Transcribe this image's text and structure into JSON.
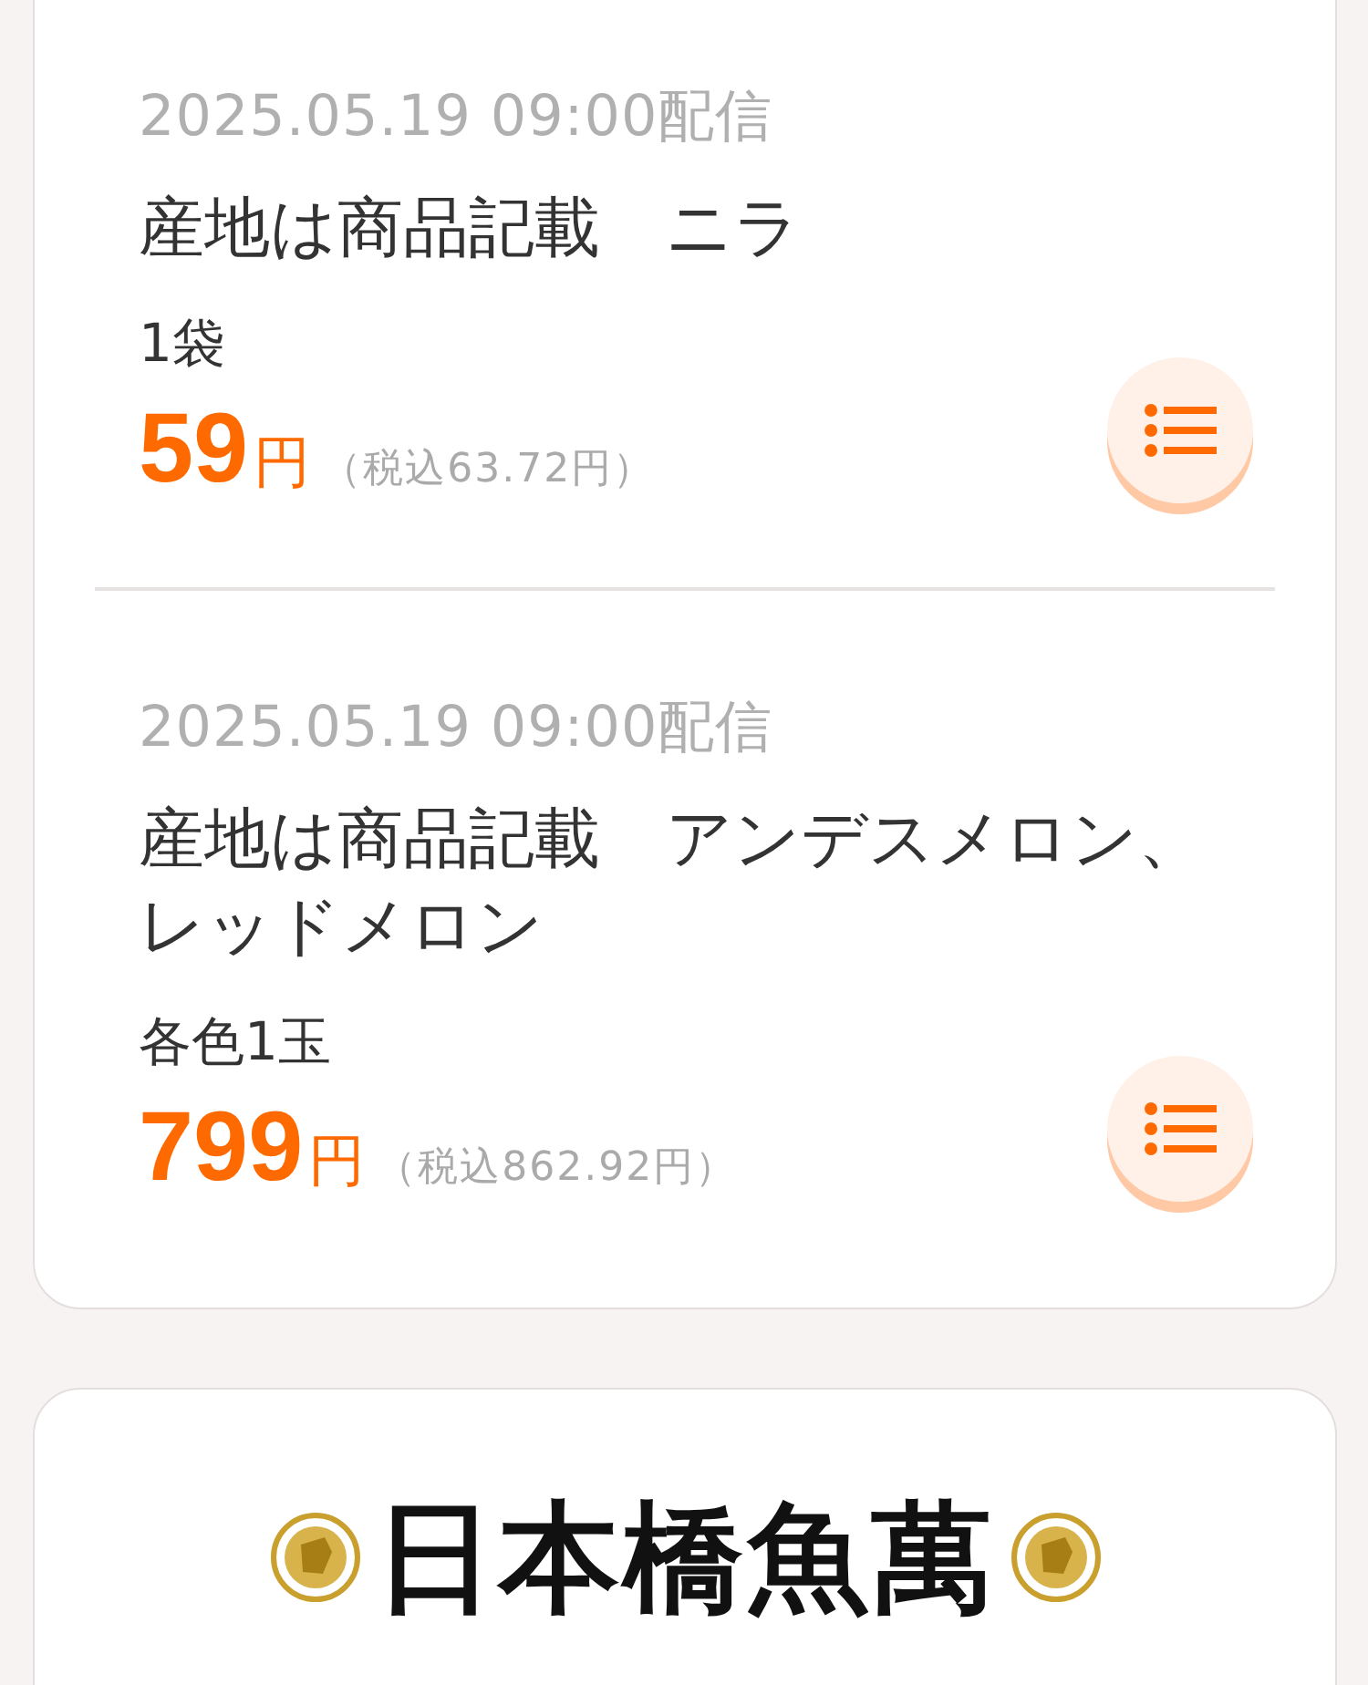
{
  "products": [
    {
      "date": "2025.05.19 09:00配信",
      "title": "産地は商品記載　ニラ",
      "unit": "1袋",
      "price": "59",
      "currency": "円",
      "tax_included": "（税込63.72円）"
    },
    {
      "date": "2025.05.19 09:00配信",
      "title": "産地は商品記載　アンデスメロン、レッドメロン",
      "unit": "各色1玉",
      "price": "799",
      "currency": "円",
      "tax_included": "（税込862.92円）"
    }
  ],
  "store": {
    "logo_text": "日本橋魚萬"
  }
}
